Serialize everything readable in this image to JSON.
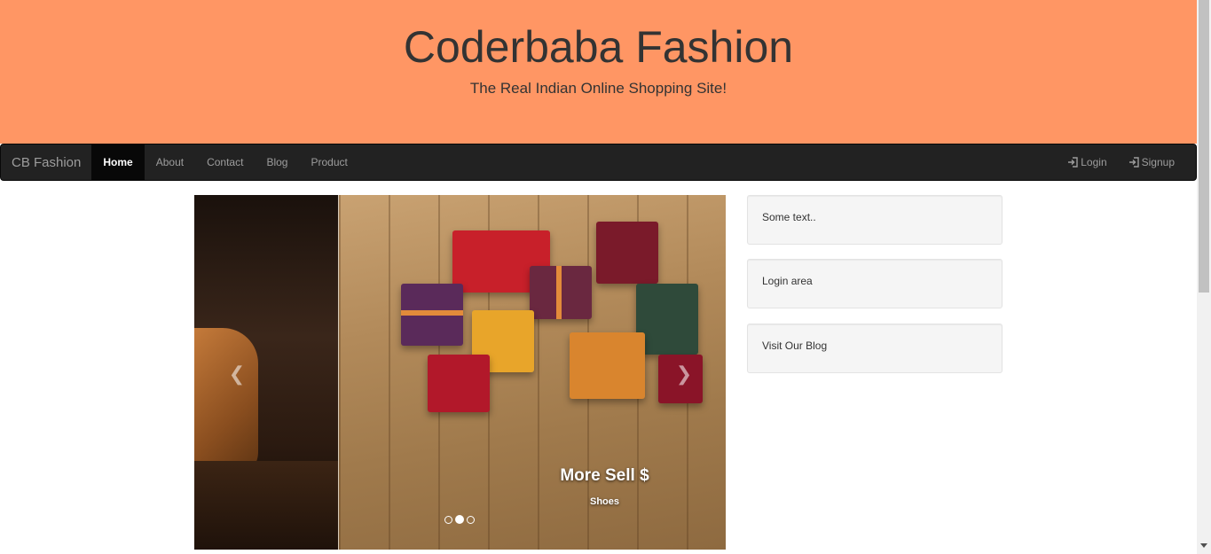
{
  "header": {
    "title": "Coderbaba Fashion",
    "subtitle": "The Real Indian Online Shopping Site!",
    "background": "#ff9664"
  },
  "navbar": {
    "brand": "CB Fashion",
    "items": [
      {
        "label": "Home",
        "active": true
      },
      {
        "label": "About"
      },
      {
        "label": "Contact"
      },
      {
        "label": "Blog"
      },
      {
        "label": "Product"
      }
    ],
    "right": [
      {
        "label": "Login",
        "icon": "login-icon"
      },
      {
        "label": "Signup",
        "icon": "login-icon"
      }
    ]
  },
  "carousel": {
    "caption_title": "More Sell $",
    "caption_text": "Shoes",
    "slide_count": 3,
    "active_index": 1,
    "prev_icon": "chevron-left-icon",
    "next_icon": "chevron-right-icon"
  },
  "sidebar": {
    "wells": [
      "Some text..",
      "Login area",
      "Visit Our Blog"
    ]
  }
}
